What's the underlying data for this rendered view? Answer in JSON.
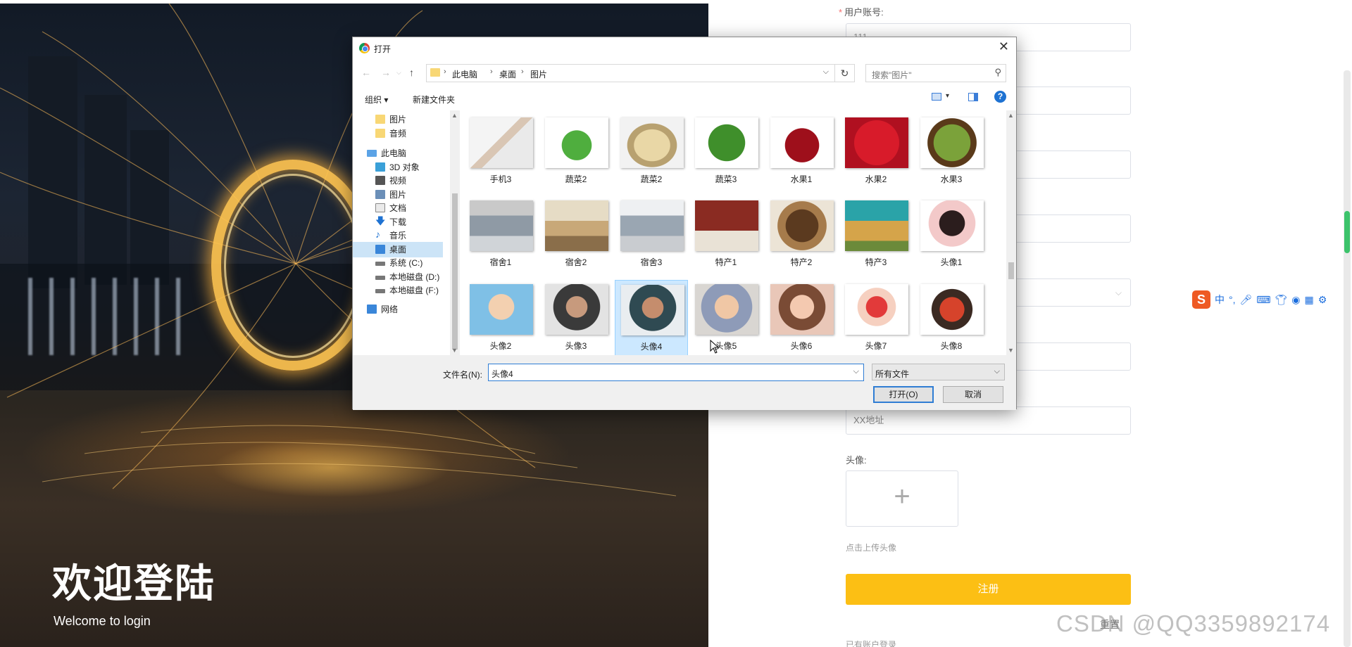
{
  "hero": {
    "title": "欢迎登陆",
    "subtitle": "Welcome to login"
  },
  "form": {
    "account_label": "用户账号:",
    "account_value": "111",
    "address_placeholder": "XX地址",
    "avatar_label": "头像:",
    "upload_tip": "点击上传头像",
    "submit_label": "注册",
    "reset_label": "重置",
    "login_link": "已有账户登录"
  },
  "dialog": {
    "title": "打开",
    "close": "✕",
    "breadcrumbs": [
      "此电脑",
      "桌面",
      "图片"
    ],
    "search_placeholder": "搜索\"图片\"",
    "organize": "组织 ▾",
    "new_folder": "新建文件夹",
    "nav_items": [
      {
        "label": "图片",
        "icon": "folder-icon"
      },
      {
        "label": "音频",
        "icon": "folder-icon"
      },
      {
        "label": "此电脑",
        "icon": "computer-icon"
      },
      {
        "label": "3D 对象",
        "icon": "cube-icon"
      },
      {
        "label": "视频",
        "icon": "video-icon"
      },
      {
        "label": "图片",
        "icon": "picture-icon"
      },
      {
        "label": "文档",
        "icon": "document-icon"
      },
      {
        "label": "下载",
        "icon": "download-icon"
      },
      {
        "label": "音乐",
        "icon": "music-icon"
      },
      {
        "label": "桌面",
        "icon": "desktop-icon"
      },
      {
        "label": "系统 (C:)",
        "icon": "drive-icon"
      },
      {
        "label": "本地磁盘 (D:)",
        "icon": "drive-icon"
      },
      {
        "label": "本地磁盘 (F:)",
        "icon": "drive-icon"
      },
      {
        "label": "网络",
        "icon": "network-icon"
      }
    ],
    "files": [
      {
        "name": "手机3"
      },
      {
        "name": "蔬菜2"
      },
      {
        "name": "蔬菜2"
      },
      {
        "name": "蔬菜3"
      },
      {
        "name": "水果1"
      },
      {
        "name": "水果2"
      },
      {
        "name": "水果3"
      },
      {
        "name": "宿舍1"
      },
      {
        "name": "宿舍2"
      },
      {
        "name": "宿舍3"
      },
      {
        "name": "特产1"
      },
      {
        "name": "特产2"
      },
      {
        "name": "特产3"
      },
      {
        "name": "头像1"
      },
      {
        "name": "头像2"
      },
      {
        "name": "头像3"
      },
      {
        "name": "头像4"
      },
      {
        "name": "头像5"
      },
      {
        "name": "头像6"
      },
      {
        "name": "头像7"
      },
      {
        "name": "头像8"
      }
    ],
    "selected_file": "头像4",
    "filename_label": "文件名(N):",
    "filename_value": "头像4",
    "filetype_value": "所有文件",
    "open_button": "打开(O)",
    "cancel_button": "取消"
  },
  "ime": {
    "mode": "中",
    "punct": "°,"
  },
  "watermark": "CSDN @QQ3359892174"
}
